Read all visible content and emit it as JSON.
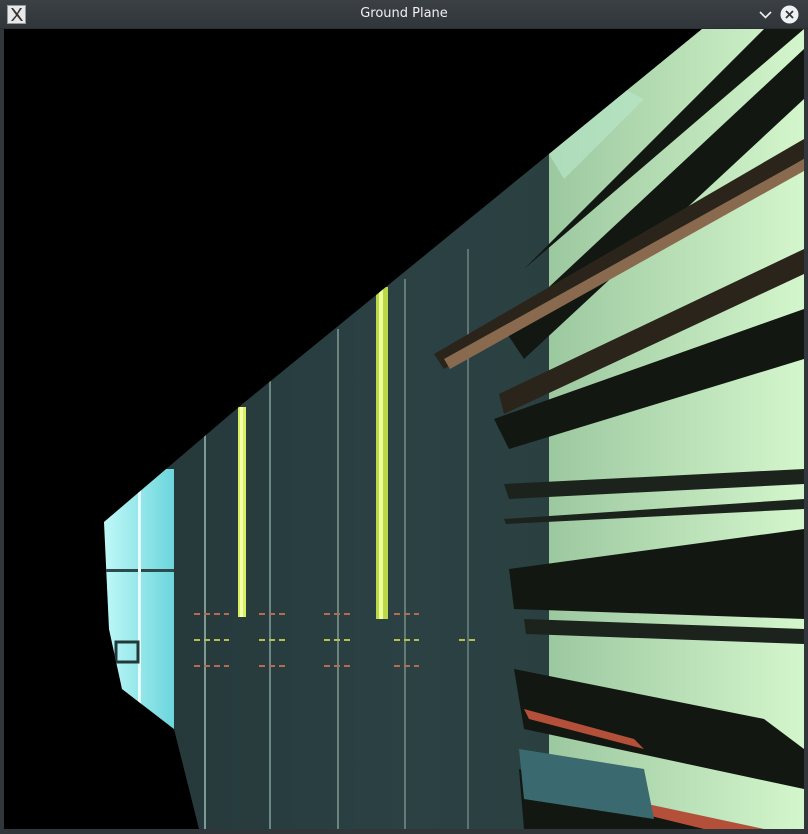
{
  "window": {
    "title": "Ground Plane"
  },
  "icons": {
    "app": "x11-app-icon",
    "minimize": "chevron-down-icon",
    "close": "close-icon"
  },
  "colors": {
    "titlebar": "#31363b",
    "title_text": "#eff0f1",
    "canvas_background": "#000000",
    "floor": "#2e4446",
    "floor_line_yellow": "#d8f060",
    "shelf_light": "#c8f0c4",
    "window_light": "#a8f4f4"
  }
}
